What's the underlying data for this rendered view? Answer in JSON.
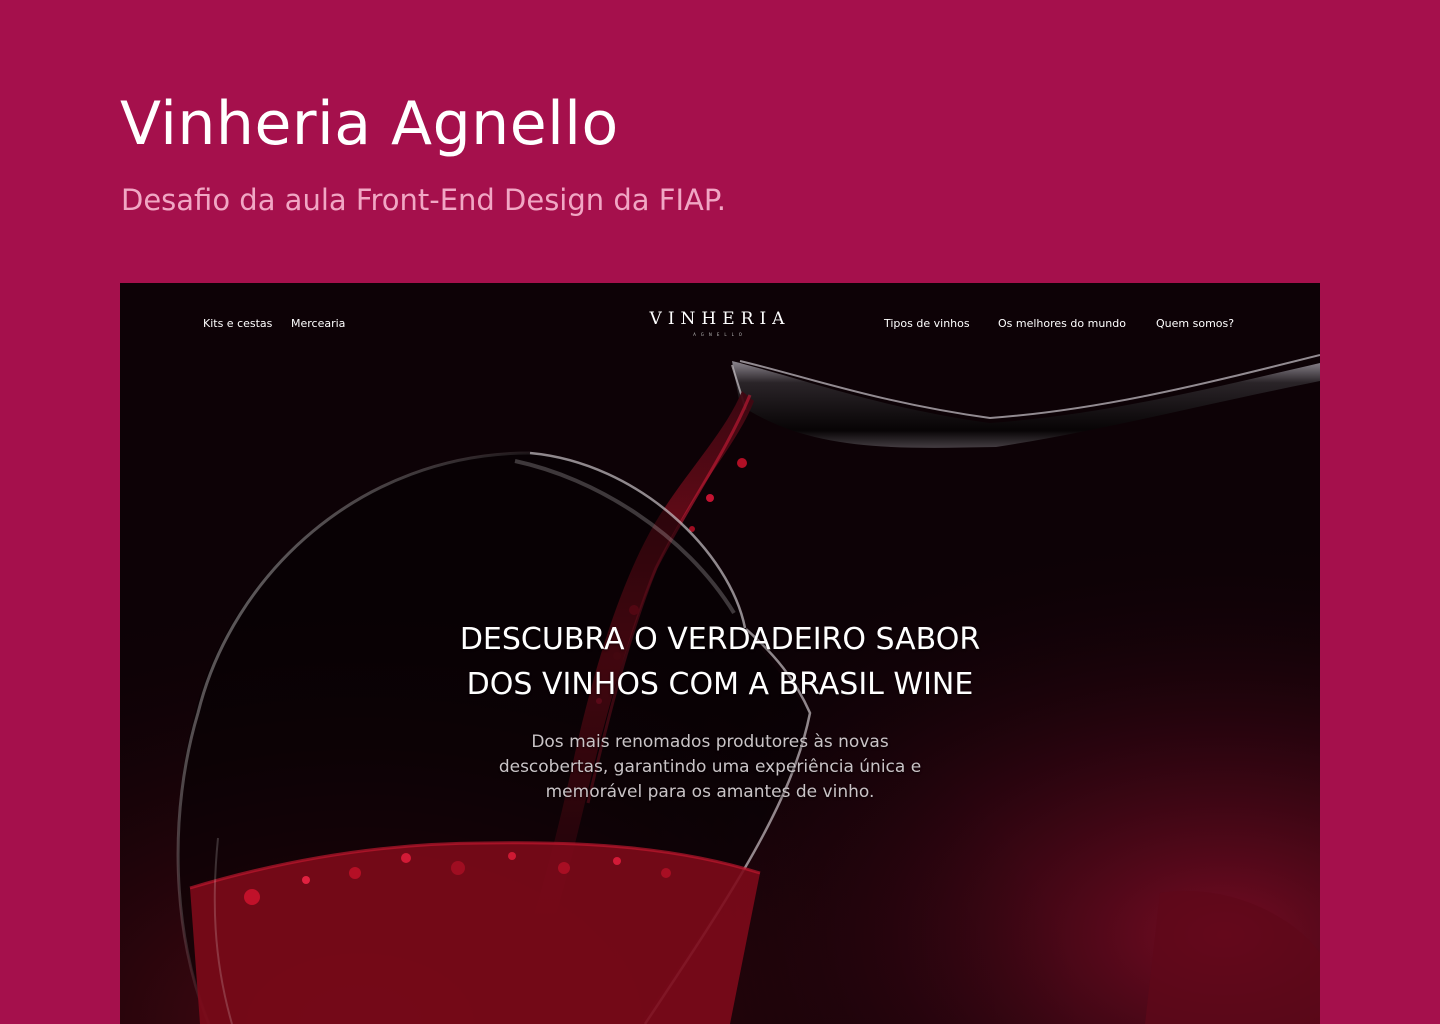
{
  "page": {
    "title": "Vinheria Agnello",
    "subtitle": "Desafio da aula Front-End Design da FIAP."
  },
  "preview": {
    "nav_left": [
      "Kits e cestas",
      "Mercearia"
    ],
    "logo": {
      "main": "VINHERIA",
      "sub": "AGNELLO"
    },
    "nav_right": [
      "Tipos de vinhos",
      "Os melhores do mundo",
      "Quem somos?"
    ],
    "hero": {
      "heading_line1": "DESCUBRA O VERDADEIRO SABOR",
      "heading_line2": "DOS VINHOS COM A BRASIL WINE",
      "body_line1": "Dos mais renomados produtores às novas",
      "body_line2": "descobertas, garantindo uma experiência única e",
      "body_line3": "memorável para os amantes de vinho."
    }
  },
  "colors": {
    "background": "#a5104c",
    "title": "#ffffff",
    "subtitle": "#f1a7c4",
    "hero_background": "#0d0206",
    "wine": "#8f0e1e"
  },
  "icons": [
    "wine-glass-image",
    "wine-bottle-image"
  ]
}
